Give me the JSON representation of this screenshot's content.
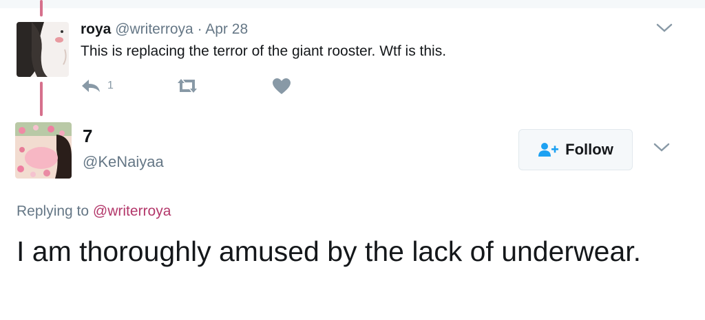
{
  "thread": {
    "parent": {
      "name": "roya",
      "handle": "@writerroya",
      "separator": "·",
      "date": "Apr 28",
      "text": "This is replacing the terror of the giant rooster. Wtf is this.",
      "reply_count": "1",
      "icons": {
        "reply": "reply-icon",
        "retweet": "retweet-icon",
        "like": "heart-icon",
        "more": "chevron-down-icon"
      }
    },
    "reply": {
      "name": "7",
      "handle": "@KeNaiyaa",
      "follow_label": "Follow",
      "replying_prefix": "Replying to",
      "replying_mention": "@writerroya",
      "text": "I am thoroughly amused by the lack of underwear.",
      "icons": {
        "follow": "add-user-icon",
        "more": "chevron-down-icon"
      }
    }
  },
  "colors": {
    "thread_line": "#d6708c",
    "mention": "#b3376a",
    "secondary_text": "#657786",
    "action_icon": "#8899a6",
    "follow_icon": "#1da1f2"
  }
}
